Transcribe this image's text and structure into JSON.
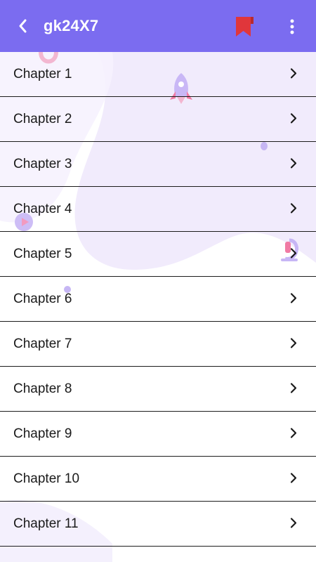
{
  "appbar": {
    "title": "gk24X7",
    "background_color": "#7b6cf0",
    "back_icon": "chevron-left-icon",
    "bookmark_icon": "bookmark-icon",
    "bookmark_color": "#e0363b",
    "more_icon": "more-vertical-icon"
  },
  "chapters": [
    {
      "label": "Chapter 1"
    },
    {
      "label": "Chapter 2"
    },
    {
      "label": "Chapter 3"
    },
    {
      "label": "Chapter 4"
    },
    {
      "label": "Chapter 5"
    },
    {
      "label": "Chapter 6"
    },
    {
      "label": "Chapter 7"
    },
    {
      "label": "Chapter 8"
    },
    {
      "label": "Chapter 9"
    },
    {
      "label": "Chapter 10"
    },
    {
      "label": "Chapter 11"
    }
  ],
  "list_item_icon": "chevron-right-icon",
  "background_decor": {
    "blob_color": "#efe9fc",
    "accent_color": "#b9a7f2",
    "icons": [
      "rocket-icon",
      "magnet-icon",
      "microscope-icon",
      "play-icon"
    ]
  }
}
